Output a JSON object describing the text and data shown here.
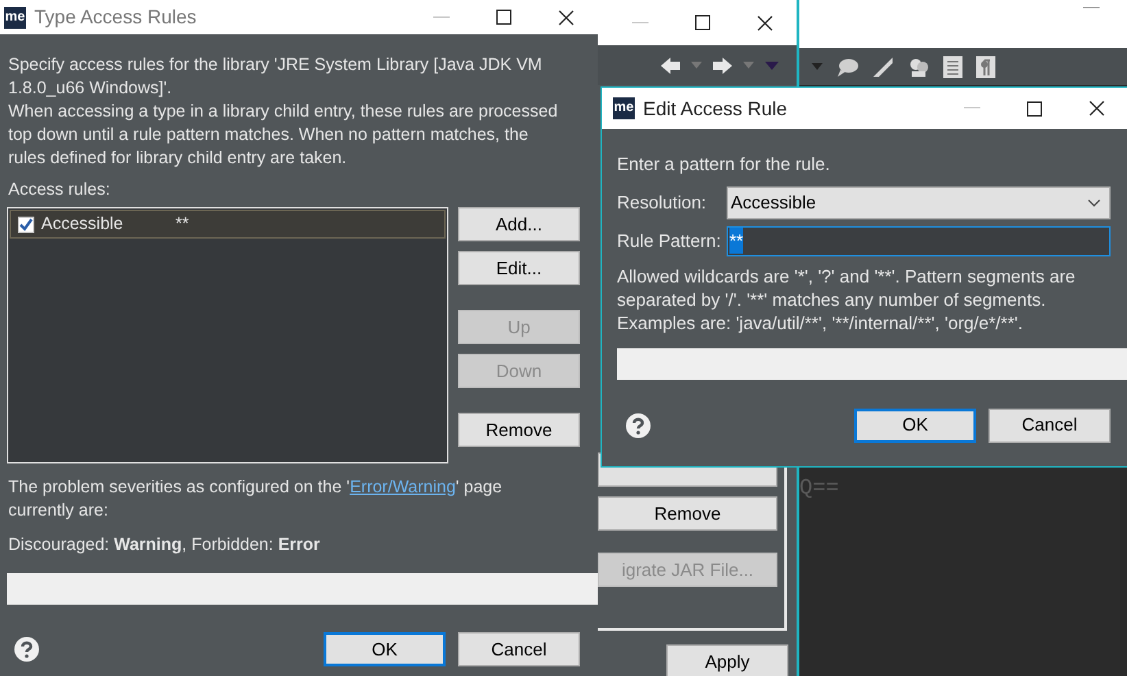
{
  "background_window": {
    "buttons": [
      {
        "label": "Remove",
        "disabled": false
      },
      {
        "label": "igrate JAR File...",
        "disabled": true
      },
      {
        "label": "Apply",
        "disabled": false
      }
    ]
  },
  "editor": {
    "text": "Q=="
  },
  "type_access_rules": {
    "logo": "me",
    "title": "Type Access Rules",
    "description": [
      "Specify access rules for the library 'JRE System Library [Java JDK VM 1.8.0_u66 Windows]'.",
      "When accessing a type in a library child entry, these rules are processed top down until a rule pattern matches. When no pattern matches, the rules defined for library child entry are taken."
    ],
    "list_label": "Access rules:",
    "rules": [
      {
        "resolution": "Accessible",
        "pattern": "**",
        "checked": true,
        "selected": true
      }
    ],
    "buttons": [
      {
        "label": "Add...",
        "disabled": false
      },
      {
        "label": "Edit...",
        "disabled": false
      },
      {
        "label": "Up",
        "disabled": true
      },
      {
        "label": "Down",
        "disabled": true
      },
      {
        "label": "Remove",
        "disabled": false
      }
    ],
    "severity": {
      "before": "The problem severities as configured on the '",
      "link": "Error/Warning",
      "after": "' page currently are:"
    },
    "summary": "Discouraged: **Warning**, Forbidden: **Error**",
    "dialog_buttons": [
      {
        "label": "OK",
        "default": true
      },
      {
        "label": "Cancel",
        "default": false
      }
    ]
  },
  "edit_access_rule": {
    "logo": "me",
    "title": "Edit Access Rule",
    "prompt": "Enter a pattern for the rule.",
    "resolution_label": "Resolution:",
    "resolution": "Accessible",
    "pattern_label": "Rule Pattern:",
    "pattern": "**",
    "help": "Allowed wildcards are '*', '?' and '**'. Pattern segments are separated by '/'. '**' matches any number of segments. Examples are: 'java/util/**', '**/internal/**', 'org/e*/**'.",
    "dialog_buttons": [
      {
        "label": "OK",
        "default": true
      },
      {
        "label": "Cancel",
        "default": false
      }
    ]
  }
}
